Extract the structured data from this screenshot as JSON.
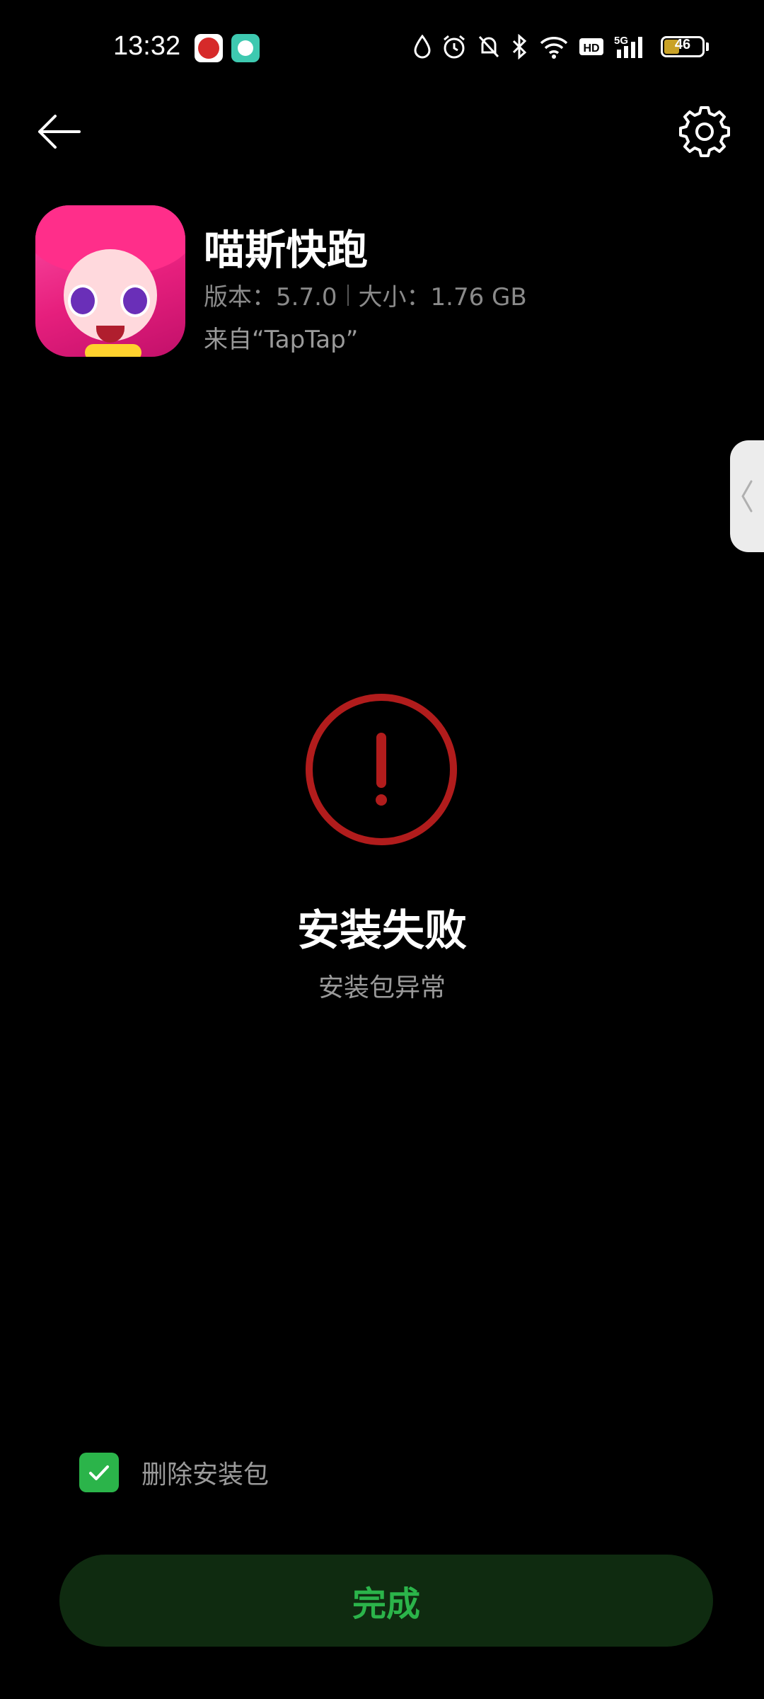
{
  "status_bar": {
    "time": "13:32",
    "network": "5G",
    "hd": "HD",
    "battery": "46"
  },
  "nav": {
    "back_icon": "arrow-left-icon",
    "settings_icon": "gear-icon"
  },
  "app": {
    "name": "喵斯快跑",
    "version": "版本：5.7.0",
    "size": "大小：1.76 GB",
    "source": "来自“TapTap”"
  },
  "status": {
    "title": "安装失败",
    "subtitle": "安装包异常",
    "icon": "error-exclamation-icon",
    "accent_color": "#b11c1c"
  },
  "delete_package": {
    "label": "删除安装包",
    "checked": true
  },
  "done_button": {
    "label": "完成",
    "text_color": "#2bb44a",
    "bg_color": "#0f2b10"
  }
}
